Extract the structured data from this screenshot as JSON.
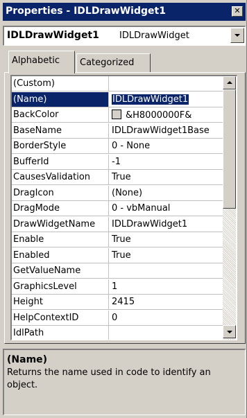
{
  "window": {
    "title": "Properties - IDLDrawWidget1",
    "close_glyph": "✕"
  },
  "object_selector": {
    "name": "IDLDrawWidget1",
    "type": "IDLDrawWidget"
  },
  "tabs": [
    {
      "label": "Alphabetic",
      "active": true
    },
    {
      "label": "Categorized",
      "active": false
    }
  ],
  "properties": [
    {
      "name": "(Custom)",
      "value": ""
    },
    {
      "name": "(Name)",
      "value": "IDLDrawWidget1",
      "selected": true
    },
    {
      "name": "BackColor",
      "value": "&H8000000F&",
      "swatch": "#d4d0c8"
    },
    {
      "name": "BaseName",
      "value": "IDLDrawWidget1Base"
    },
    {
      "name": "BorderStyle",
      "value": "0 - None"
    },
    {
      "name": "BufferId",
      "value": "-1"
    },
    {
      "name": "CausesValidation",
      "value": "True"
    },
    {
      "name": "DragIcon",
      "value": "(None)"
    },
    {
      "name": "DragMode",
      "value": "0 - vbManual"
    },
    {
      "name": "DrawWidgetName",
      "value": "IDLDrawWidget1"
    },
    {
      "name": "Enable",
      "value": "True"
    },
    {
      "name": "Enabled",
      "value": "True"
    },
    {
      "name": "GetValueName",
      "value": ""
    },
    {
      "name": "GraphicsLevel",
      "value": "1"
    },
    {
      "name": "Height",
      "value": "2415"
    },
    {
      "name": "HelpContextID",
      "value": "0"
    },
    {
      "name": "IdlPath",
      "value": ""
    }
  ],
  "description": {
    "title": "(Name)",
    "text": "Returns the name used in code to identify an object."
  },
  "colors": {
    "title_bar": "#0a246a",
    "face": "#d4d0c8",
    "selection": "#0a246a"
  },
  "icons": {
    "close": "close-icon",
    "dropdown": "chevron-down-icon",
    "scroll_up": "scroll-up-arrow-icon",
    "scroll_down": "scroll-down-arrow-icon"
  }
}
